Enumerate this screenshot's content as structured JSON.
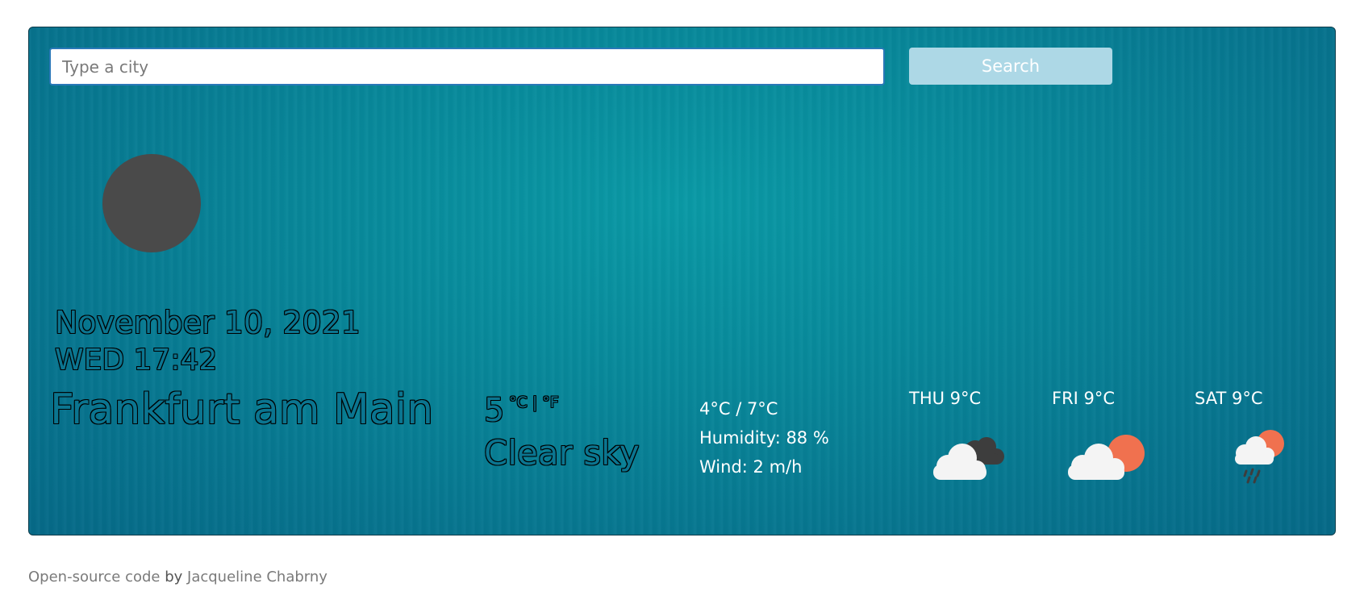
{
  "search": {
    "placeholder": "Type a city",
    "button_label": "Search"
  },
  "current": {
    "date": "November 10, 2021",
    "day_time": "WED 17:42",
    "city": "Frankfurt am Main",
    "temperature": "5",
    "unit_c": "°C",
    "unit_sep": "|",
    "unit_f": "°F",
    "description": "Clear sky",
    "min_max": "4°C / 7°C",
    "humidity": "Humidity: 88 %",
    "wind": "Wind: 2 m/h"
  },
  "forecast": [
    {
      "label": "THU 9°C",
      "icon": "cloud-dark-cloud-icon"
    },
    {
      "label": "FRI 9°C",
      "icon": "sun-behind-cloud-icon"
    },
    {
      "label": "SAT 9°C",
      "icon": "rain-cloud-sun-icon"
    }
  ],
  "footer": {
    "link_text": "Open-source code",
    "by": " by ",
    "author": "Jacqueline Chabrny"
  },
  "colors": {
    "button_bg": "#add8e6",
    "card_bg": "#0a9aa6",
    "avatar": "#4a4a4a",
    "sun": "#f0714f",
    "cloud": "#f4f4f4",
    "dark_cloud": "#3d3d3d"
  }
}
